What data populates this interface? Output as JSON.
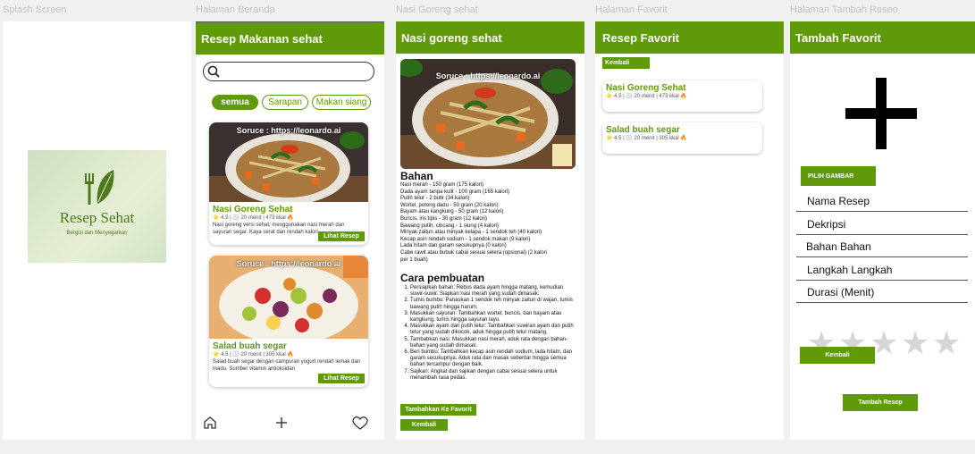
{
  "frames": {
    "splash": "Splash Screen",
    "beranda": "Halaman Beranda",
    "detail": "Nasi Goreng sehat",
    "favorit": "Halaman Favorit",
    "tambah": "Halaman Tambah Reseo"
  },
  "splash": {
    "app_name": "Resep Sehat",
    "tagline": "Bergizi dan Menyegarkan"
  },
  "beranda": {
    "appbar_title": "Resep Makanan sehat",
    "search_placeholder": "",
    "chips": [
      "semua",
      "Sarapan",
      "Makan siang"
    ],
    "cards": [
      {
        "watermark": "Soruce : https://leonardo.ai",
        "title": "Nasi Goreng Sehat",
        "meta": "⭐ 4.5 | 🕓 20 menit | 473 kkal 🔥",
        "desc": "Nasi goreng versi sehat, menggunakan nasi merah dan sayuran segar. Kaya serat dan rendah kalori.",
        "button": "Lihat Resep"
      },
      {
        "watermark": "Soruce : https://leonardo.ai",
        "title": "Salad buah segar",
        "meta": "⭐ 4.5 | 🕓 20 menit | 305 kkal 🔥",
        "desc": "Salad buah segar dengan campuran yogurt rendah lemak dan madu. Sumber vitamin antioksidan",
        "button": "Lihat Resep"
      }
    ]
  },
  "detail": {
    "appbar_title": "Nasi goreng sehat",
    "watermark": "Soruce : https://leonardo.ai",
    "bahan_title": "Bahan",
    "bahan": [
      "Nasi merah - 150 gram (175 kalori)",
      "Dada ayam tanpa kulit - 100 gram (165 kalori)",
      "Putih telur - 2 butir (34 kalori)",
      "Wortel, potong dadu - 50 gram (20 kalori)",
      "Bayam atau kangkung - 50 gram (12 kalori)",
      "Buncis, iris tipis - 30 gram (12 kalori)",
      "Bawang putih, cincang - 1 siung (4 kalori)",
      "Minyak zaitun atau minyak kelapa - 1 sendok teh (40 kalori)",
      "Kecap asin rendah sodium - 1 sendok makan (9 kalori)",
      "Lada hitam dan garam secukupnya (0 kalori)",
      "Cabe rawit atau bubuk cabai sesuai selera (opsional) (2 kalori per 1 buah)"
    ],
    "cara_title": "Cara pembuatan",
    "cara": [
      "Persiapkan bahan: Rebus dada ayam hingga matang, kemudian suwir-suwir. Siapkan nasi merah yang sudah dimasak.",
      "Tumis bumbu: Panaskan 1 sendok teh minyak zaitun di wajan, tumis bawang putih hingga harum.",
      "Masukkan sayuran: Tambahkan wortel, buncis, dan bayam atau kangkung, tumis hingga sayuran layu.",
      "Masukkan ayam dan putih telur: Tambahkan suwiran ayam dan putih telur yang sudah dikocok, aduk hingga putih telur matang.",
      "Tambahkan nasi: Masukkan nasi merah, aduk rata dengan bahan-bahan yang sudah dimasak.",
      "Beri bumbu: Tambahkan kecap asin rendah sodium, lada hitam, dan garam secukupnya. Aduk rata dan masak sebentar hingga semua bahan tercampur dengan baik.",
      "Sajikan: Angkat dan sajikan dengan cabai sesuai selera untuk menambah rasa pedas."
    ],
    "fav_button": "Tambahkan Ke Favorit",
    "back_button": "Kembali"
  },
  "favorit": {
    "appbar_title": "Resep Favorit",
    "back_button": "Kembali",
    "items": [
      {
        "title": "Nasi Goreng Sehat",
        "meta": "⭐ 4.5 | 🕓 20 menit | 473 kkal 🔥"
      },
      {
        "title": "Salad buah segar",
        "meta": "⭐ 4.5 | 🕓 20 menit | 305 kkal 🔥"
      }
    ]
  },
  "tambah": {
    "appbar_title": "Tambah Favorit",
    "pick_image": "PILIH GAMBAR",
    "fields": [
      "Nama Resep",
      "Dekripsi",
      "Bahan Bahan",
      "Langkah Langkah",
      "Durasi (Menit)"
    ],
    "rating_stars": 5,
    "rating_value": 0,
    "back_button": "Kembali",
    "submit_button": "Tambah Resep"
  },
  "colors": {
    "primary": "#5f9a08",
    "star_empty": "#d6d6d6"
  }
}
